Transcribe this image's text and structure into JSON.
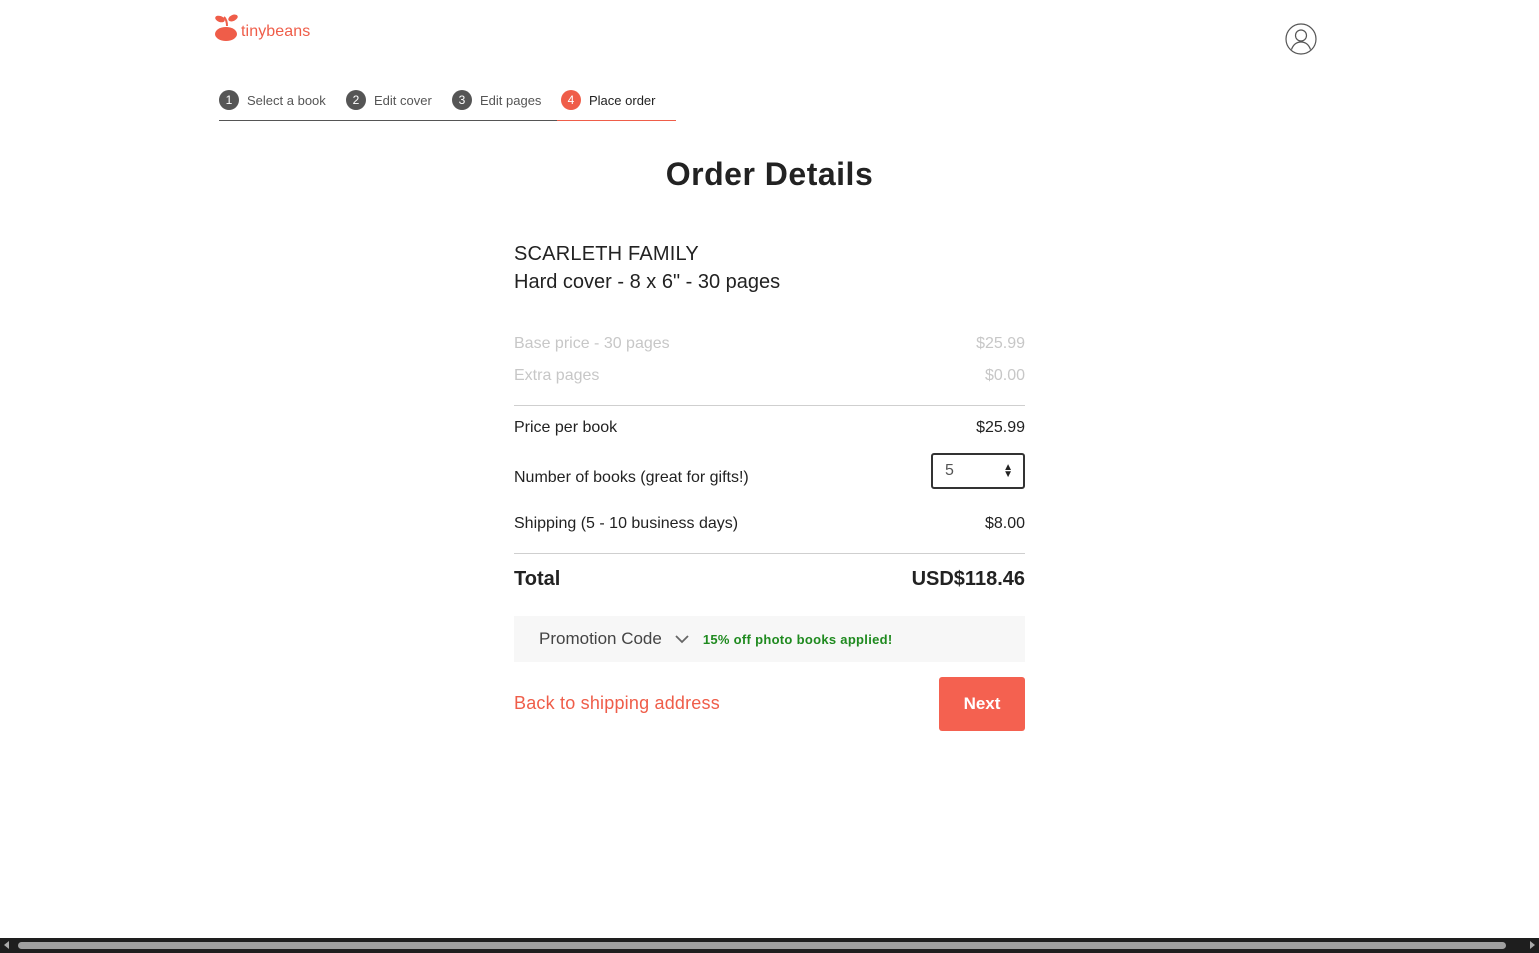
{
  "header": {
    "logo_text": "tinybeans",
    "brand_color": "#ef5d49",
    "avatar_icon": "user-avatar-icon"
  },
  "steps": [
    {
      "num": "1",
      "label": "Select a book",
      "active": false
    },
    {
      "num": "2",
      "label": "Edit cover",
      "active": false
    },
    {
      "num": "3",
      "label": "Edit pages",
      "active": false
    },
    {
      "num": "4",
      "label": "Place order",
      "active": true
    }
  ],
  "page_title": "Order Details",
  "book": {
    "name": "SCARLETH FAMILY",
    "spec": "Hard cover - 8 x 6\" - 30 pages"
  },
  "pricing": {
    "base_label": "Base price - 30 pages",
    "base_value": "$25.99",
    "extra_label": "Extra pages",
    "extra_value": "$0.00",
    "per_book_label": "Price per book",
    "per_book_value": "$25.99",
    "quantity_label": "Number of books (great for gifts!)",
    "quantity_value": "5",
    "shipping_label": "Shipping (5 - 10 business days)",
    "shipping_value": "$8.00",
    "total_label": "Total",
    "total_value": "USD$118.46"
  },
  "promotion": {
    "label": "Promotion Code",
    "message": "15% off photo books applied!",
    "message_color": "#1f8a1f"
  },
  "actions": {
    "back_label": "Back to shipping address",
    "next_label": "Next",
    "next_color": "#f46150"
  }
}
